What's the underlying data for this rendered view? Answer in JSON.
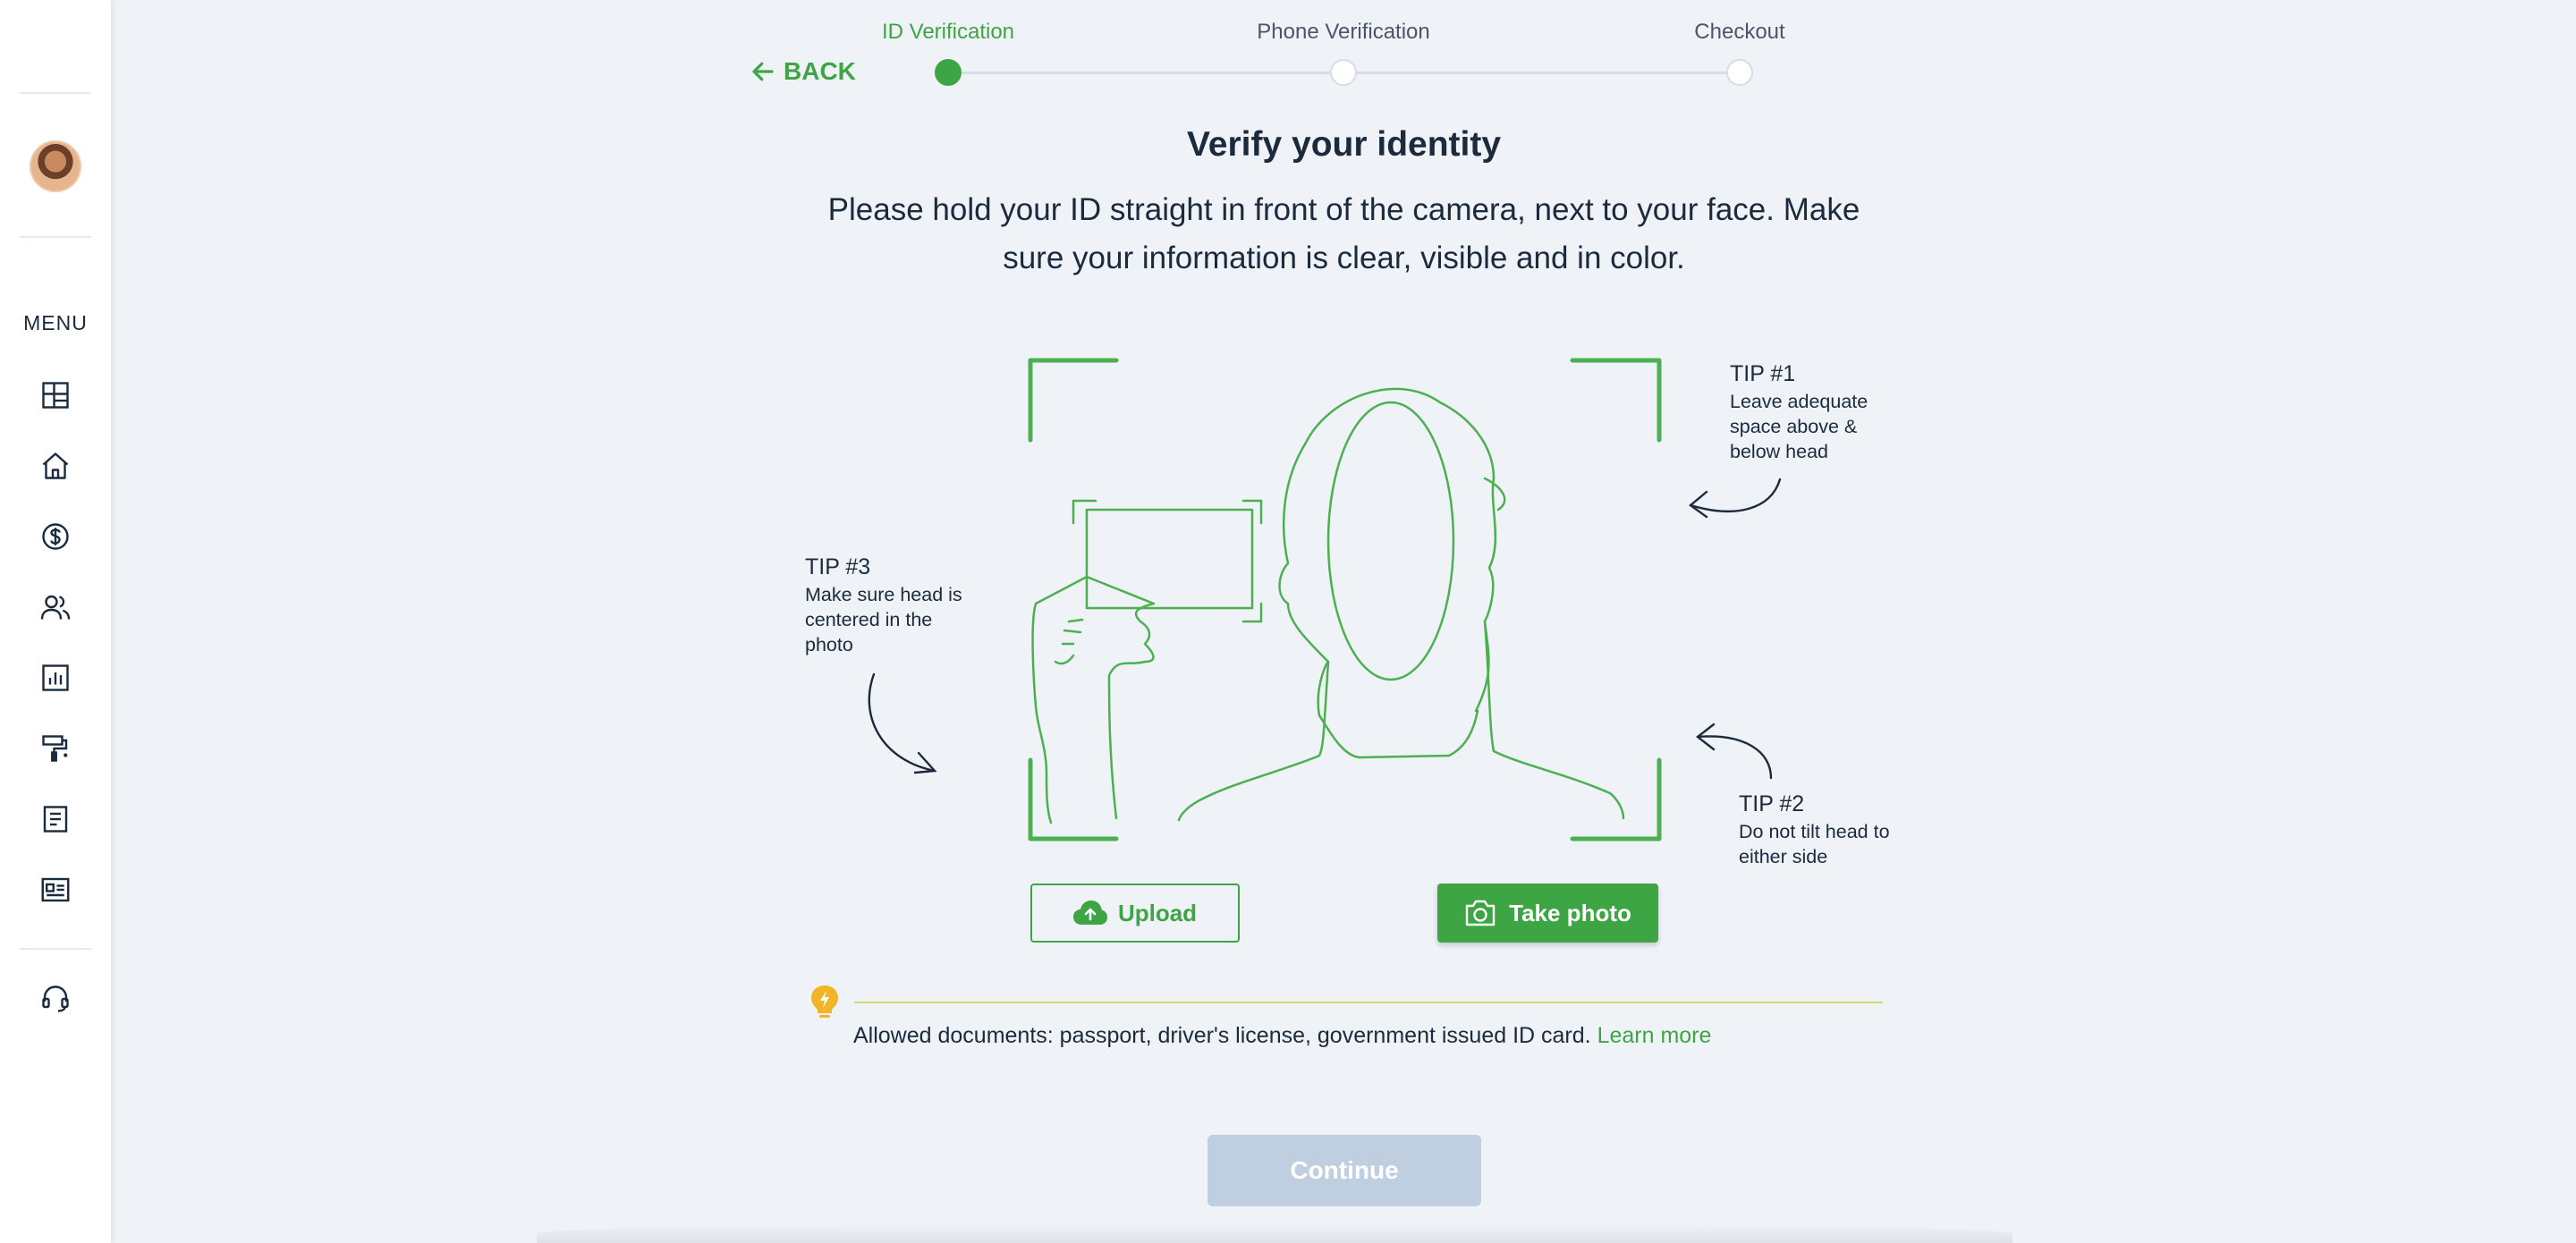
{
  "sidebar": {
    "menu_label": "MENU",
    "icons": [
      "dashboard-icon",
      "home-icon",
      "dollar-icon",
      "users-icon",
      "chart-icon",
      "paint-roller-icon",
      "document-icon",
      "id-card-icon",
      "headset-icon"
    ]
  },
  "stepper": {
    "back_label": "BACK",
    "steps": [
      {
        "label": "ID Verification",
        "active": true
      },
      {
        "label": "Phone Verification",
        "active": false
      },
      {
        "label": "Checkout",
        "active": false
      }
    ]
  },
  "main": {
    "title": "Verify your identity",
    "subtitle": "Please hold your ID straight in front of the camera, next to your face. Make sure your information is clear, visible and in color."
  },
  "tips": {
    "tip1": {
      "title": "TIP #1",
      "body": "Leave adequate space above & below head"
    },
    "tip2": {
      "title": "TIP #2",
      "body": "Do not tilt head to either side"
    },
    "tip3": {
      "title": "TIP #3",
      "body": "Make sure head is centered in the photo"
    }
  },
  "actions": {
    "upload_label": "Upload",
    "take_photo_label": "Take photo",
    "continue_label": "Continue"
  },
  "notice": {
    "text": "Allowed documents: passport, driver's license, government issued ID card.",
    "link": "Learn more"
  },
  "colors": {
    "accent": "#3da543",
    "background": "#eff3f7",
    "text": "#1b2a3d",
    "disabled": "#bfcfdf",
    "bulb": "#f2b52a"
  }
}
